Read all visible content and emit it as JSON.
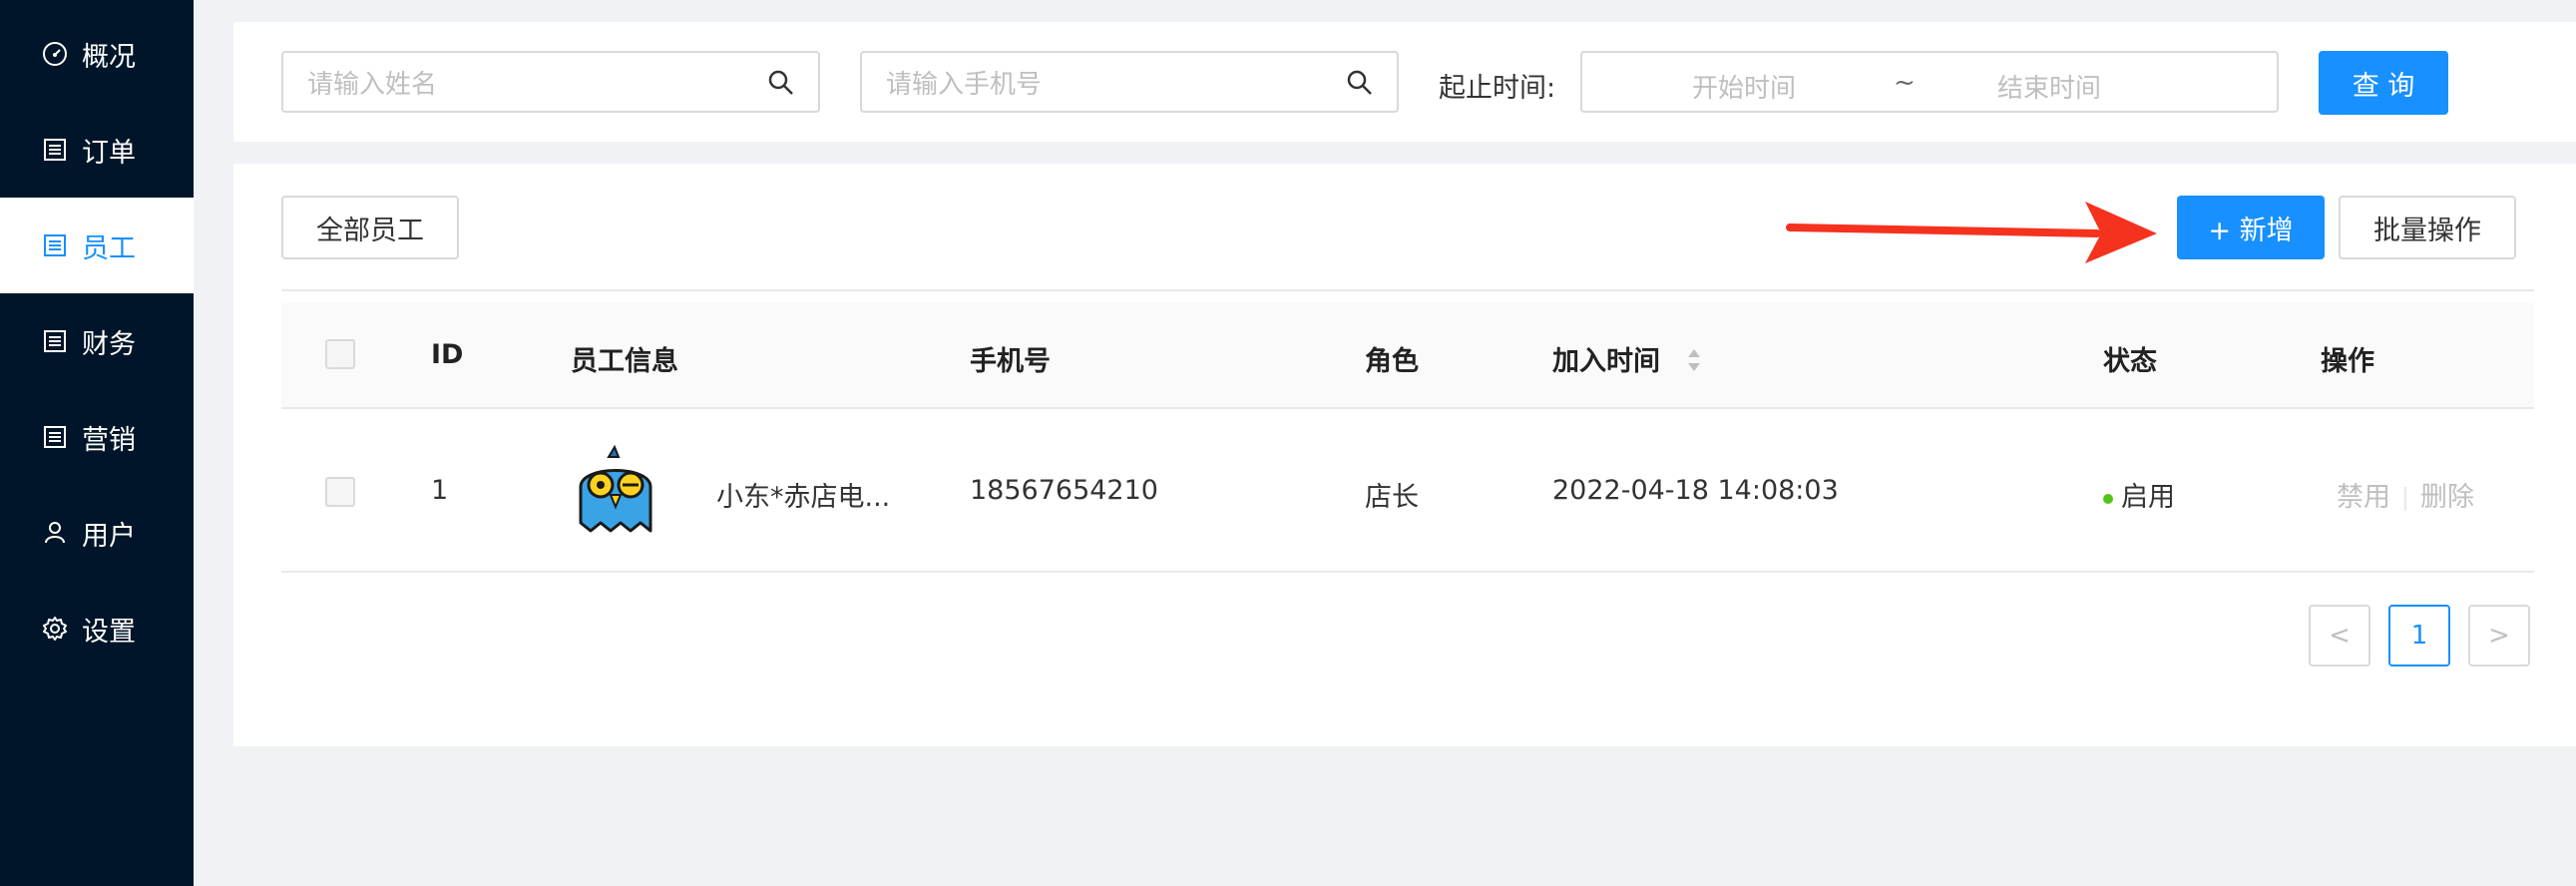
{
  "sidebar": {
    "items": [
      {
        "label": "概况",
        "icon": "dashboard-icon"
      },
      {
        "label": "订单",
        "icon": "list-icon"
      },
      {
        "label": "员工",
        "icon": "list-icon",
        "active": true
      },
      {
        "label": "财务",
        "icon": "list-icon"
      },
      {
        "label": "营销",
        "icon": "list-icon"
      },
      {
        "label": "用户",
        "icon": "user-icon"
      },
      {
        "label": "设置",
        "icon": "gear-icon"
      }
    ]
  },
  "search": {
    "name_placeholder": "请输入姓名",
    "phone_placeholder": "请输入手机号",
    "time_label": "起止时间:",
    "start_placeholder": "开始时间",
    "range_separator": "~",
    "end_placeholder": "结束时间",
    "query_label": "查 询"
  },
  "toolbar": {
    "all_staff_label": "全部员工",
    "add_label": "+ 新增",
    "batch_label": "批量操作"
  },
  "table": {
    "headers": {
      "id": "ID",
      "info": "员工信息",
      "phone": "手机号",
      "role": "角色",
      "joined": "加入时间",
      "status": "状态",
      "actions": "操作"
    },
    "rows": [
      {
        "id": "1",
        "name": "小东*赤店电...",
        "phone": "18567654210",
        "role": "店长",
        "joined": "2022-04-18 14:08:03",
        "status": "启用",
        "action_disable": "禁用",
        "action_delete": "删除"
      }
    ]
  },
  "pagination": {
    "prev": "<",
    "current": "1",
    "next": ">"
  },
  "colors": {
    "sidebar_bg": "#001529",
    "primary": "#1890ff",
    "status_enabled": "#52c41a",
    "annotation_arrow": "#f5321e"
  }
}
